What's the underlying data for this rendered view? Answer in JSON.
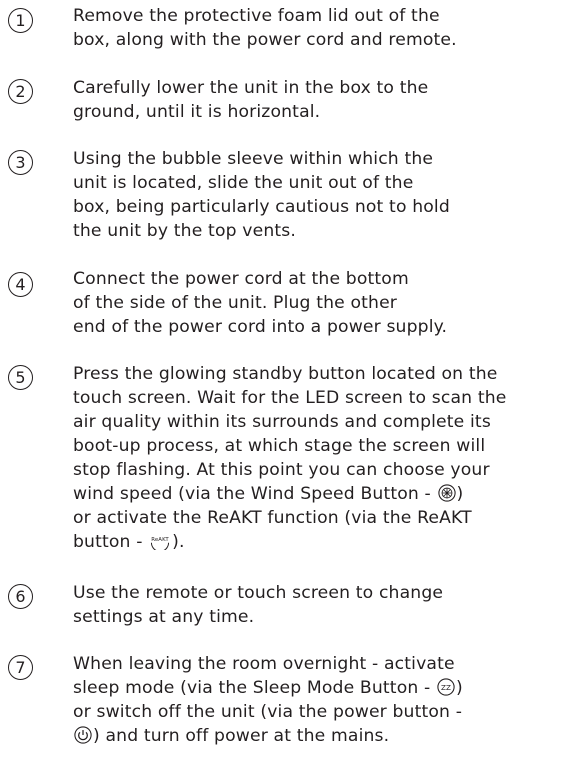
{
  "steps": [
    {
      "number": "1",
      "text": "Remove the protective foam lid out of the\nbox, along with the power cord and remote."
    },
    {
      "number": "2",
      "text": "Carefully lower the unit in the box to the\nground, until it is horizontal."
    },
    {
      "number": "3",
      "text": "Using the bubble sleeve within which the\nunit is located, slide the unit out of the\nbox, being particularly cautious not to hold\nthe unit by the top vents."
    },
    {
      "number": "4",
      "text": "Connect the power cord at the bottom\nof the side of the unit. Plug the other\nend of the power cord into a power supply."
    },
    {
      "number": "5",
      "text_a": "Press the glowing standby button located on the\ntouch screen. Wait for the LED screen to scan the\nair quality within its surrounds and complete its\nboot-up process, at which stage the screen will\nstop flashing. At this point you can choose your\nwind speed (via the Wind Speed Button - ",
      "text_b": ")\nor activate the ReAKT function (via the ReAKT\nbutton - ",
      "text_c": ").",
      "icon_wind": "fan-icon",
      "icon_reakt": "reakt-icon",
      "icon_reakt_label": "ReAKT"
    },
    {
      "number": "6",
      "text": "Use the remote or touch screen to change\nsettings at any time."
    },
    {
      "number": "7",
      "text_a": "When leaving the room overnight - activate\nsleep mode (via the Sleep Mode Button - ",
      "text_b": ")\nor switch off the unit (via the power button -\n",
      "text_c": ") and turn off power at the mains.",
      "icon_sleep": "sleep-icon",
      "icon_sleep_label": "ZZ",
      "icon_power": "power-icon"
    }
  ]
}
